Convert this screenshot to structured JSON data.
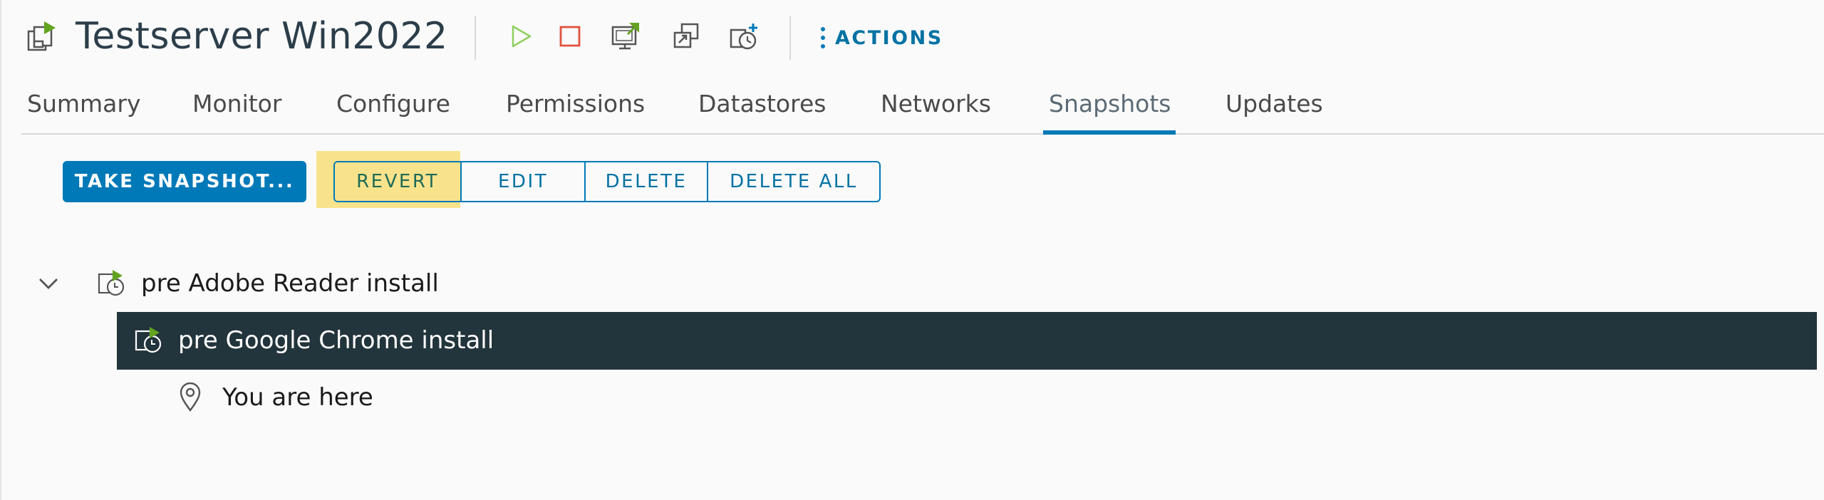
{
  "header": {
    "title": "Testserver Win2022",
    "actions_label": "ACTIONS",
    "toolbar_icons": [
      "power-on-icon",
      "power-off-icon",
      "launch-console-icon",
      "migrate-icon",
      "snapshot-manage-icon"
    ]
  },
  "tabs": [
    {
      "label": "Summary"
    },
    {
      "label": "Monitor"
    },
    {
      "label": "Configure"
    },
    {
      "label": "Permissions"
    },
    {
      "label": "Datastores"
    },
    {
      "label": "Networks"
    },
    {
      "label": "Snapshots",
      "active": true
    },
    {
      "label": "Updates"
    }
  ],
  "toolbar": {
    "take_snapshot": "TAKE SNAPSHOT...",
    "revert": "REVERT",
    "edit": "EDIT",
    "delete": "DELETE",
    "delete_all": "DELETE ALL"
  },
  "tree": {
    "root": {
      "label": "pre Adobe Reader install",
      "expanded": true
    },
    "child": {
      "label": "pre Google Chrome install",
      "selected": true
    },
    "here": {
      "label": "You are here"
    }
  },
  "colors": {
    "accent": "#0079b8",
    "highlight": "#f8e38c",
    "selected_row": "#22343c",
    "power_on": "#8fcf60",
    "power_off": "#e0533f",
    "snapshot_flag": "#62a420"
  }
}
